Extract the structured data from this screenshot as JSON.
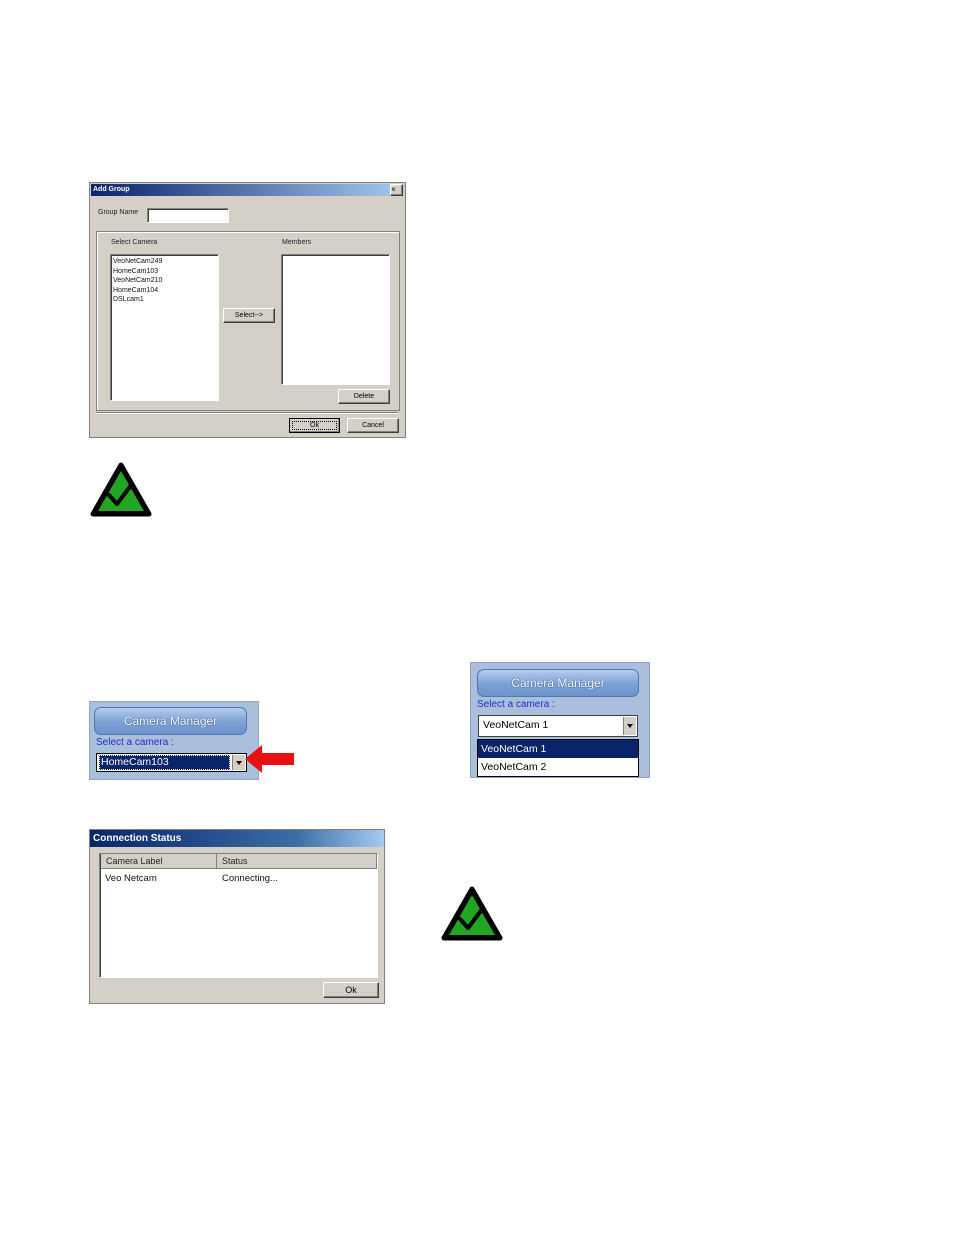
{
  "add_group": {
    "title": "Add Group",
    "group_name_label": "Group Name",
    "group_name_value": "",
    "select_camera_label": "Select Camera",
    "members_label": "Members",
    "cameras": [
      "VeoNetCam249",
      "HomeCam103",
      "VeoNetCam210",
      "HomeCam104",
      "DSLcam1"
    ],
    "members": [],
    "select_button": "Select-->",
    "delete_button": "Delete",
    "ok_button": "Ok",
    "cancel_button": "Cancel"
  },
  "camera_manager_left": {
    "title": "Camera Manager",
    "select_label": "Select a camera :",
    "selected_value": "HomeCam103"
  },
  "camera_manager_right": {
    "title": "Camera Manager",
    "select_label": "Select a camera :",
    "selected_value": "VeoNetCam 1",
    "options": [
      "VeoNetCam 1",
      "VeoNetCam 2"
    ]
  },
  "connection_status": {
    "title": "Connection Status",
    "columns": [
      "Camera Label",
      "Status"
    ],
    "rows": [
      {
        "label": "Veo Netcam",
        "status": "Connecting..."
      }
    ],
    "ok_button": "Ok"
  },
  "colors": {
    "note_icon_green": "#22a522",
    "arrow_red": "#e81010",
    "selection_blue": "#0a246a"
  }
}
